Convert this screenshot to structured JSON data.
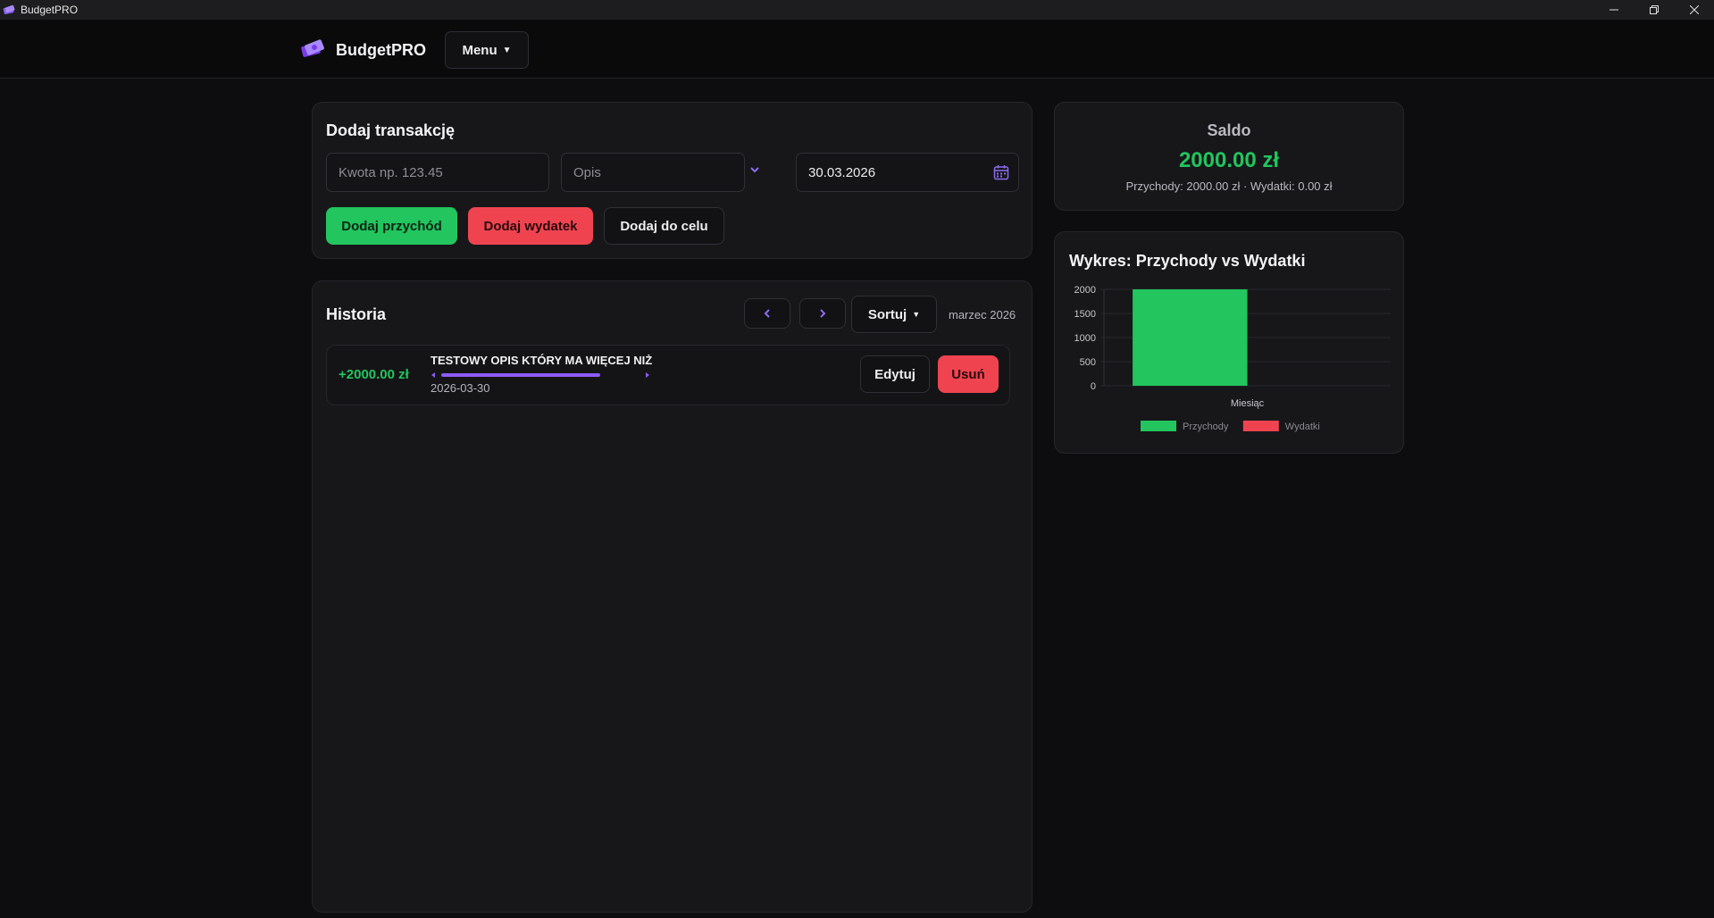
{
  "window": {
    "title": "BudgetPRO",
    "controls": [
      "minimize-icon",
      "restore-icon",
      "close-icon"
    ]
  },
  "header": {
    "brand": "BudgetPRO",
    "menu_label": "Menu",
    "menu_caret": "▼"
  },
  "add_transaction": {
    "title": "Dodaj transakcję",
    "amount_placeholder": "Kwota np. 123.45",
    "desc_placeholder": "Opis",
    "date_value": "30.03.2026",
    "add_income_label": "Dodaj przychód",
    "add_expense_label": "Dodaj wydatek",
    "add_goal_label": "Dodaj do celu"
  },
  "history": {
    "title": "Historia",
    "prev_label": "‹",
    "next_label": "›",
    "sort_label": "Sortuj",
    "sort_caret": "▼",
    "month_label": "marzec 2026",
    "transactions": [
      {
        "amount": "+2000.00 zł",
        "description": "TESTOWY OPIS KTÓRY MA WIĘCEJ NIŻ",
        "date": "2026-03-30",
        "edit_label": "Edytuj",
        "delete_label": "Usuń"
      }
    ]
  },
  "balance": {
    "label": "Saldo",
    "value": "2000.00 zł",
    "summary": "Przychody: 2000.00 zł · Wydatki: 0.00 zł"
  },
  "chart_title": "Wykres: Przychody vs Wydatki",
  "colors": {
    "income": "#22c55e",
    "expense": "#ef4450",
    "accent": "#8b5cf6"
  },
  "chart_data": {
    "type": "bar",
    "categories": [
      "Miesiąc"
    ],
    "series": [
      {
        "name": "Przychody",
        "values": [
          2000
        ],
        "color": "#22c55e"
      },
      {
        "name": "Wydatki",
        "values": [
          0
        ],
        "color": "#ef4450"
      }
    ],
    "xlabel": "",
    "ylabel": "",
    "ylim": [
      0,
      2000
    ],
    "yticks": [
      0,
      500,
      1000,
      1500,
      2000
    ],
    "grid": true,
    "legend": "bottom"
  }
}
